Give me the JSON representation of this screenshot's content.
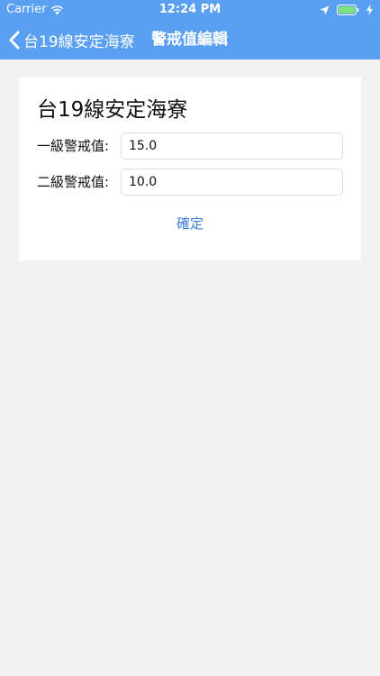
{
  "status_bar": {
    "carrier": "Carrier",
    "time": "12:24 PM",
    "icons": [
      "wifi-icon",
      "location-arrow-icon",
      "battery-icon",
      "charging-bolt-icon"
    ]
  },
  "nav": {
    "back_label": "台19線安定海寮",
    "title": "警戒值編輯",
    "background_color": "#5aa0f2"
  },
  "form": {
    "station_name": "台19線安定海寮",
    "level1_label": "一級警戒值:",
    "level1_value": "15.0",
    "level2_label": "二級警戒值:",
    "level2_value": "10.0",
    "confirm_label": "確定",
    "accent_color": "#3d7fd8"
  }
}
